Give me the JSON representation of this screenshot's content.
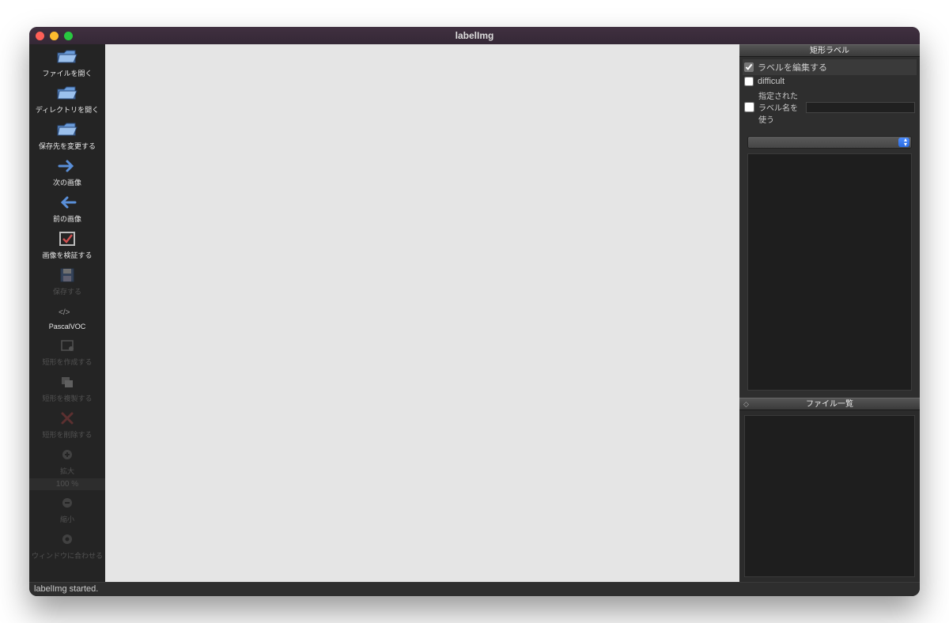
{
  "window": {
    "title": "labelImg"
  },
  "toolbar": {
    "open_file": "ファイルを開く",
    "open_dir": "ディレクトリを開く",
    "change_save_dir": "保存先を変更する",
    "next_image": "次の画像",
    "prev_image": "前の画像",
    "verify_image": "画像を検証する",
    "save": "保存する",
    "format": "PascalVOC",
    "create_rect": "短形を作成する",
    "duplicate_rect": "短形を複製する",
    "delete_rect": "短形を削除する",
    "zoom_in": "拡大",
    "zoom_value": "100 %",
    "zoom_out": "縮小",
    "fit_window": "ウィンドウに合わせる"
  },
  "right_panel": {
    "labels_header": "矩形ラベル",
    "edit_label": "ラベルを編集する",
    "difficult": "difficult",
    "use_default_label": "指定されたラベル名を使う",
    "file_list_header": "ファイル一覧"
  },
  "statusbar": {
    "message": "labelImg started."
  }
}
